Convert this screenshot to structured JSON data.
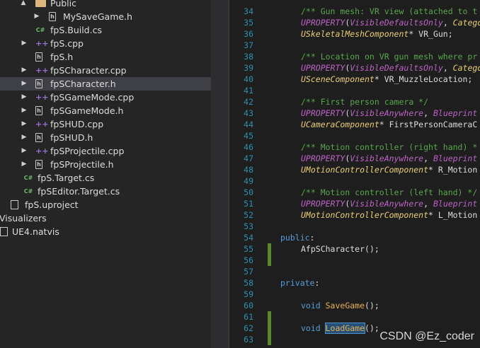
{
  "explorer": {
    "items": [
      {
        "label": "Public",
        "icon": "folder-icon",
        "arrow": "▲",
        "selected": false
      },
      {
        "label": "MySaveGame.h",
        "icon": "header-file-icon",
        "arrow": "▶",
        "selected": false
      },
      {
        "label": "fpS.Build.cs",
        "icon": "csharp-file-icon",
        "arrow": "",
        "selected": false
      },
      {
        "label": "fpS.cpp",
        "icon": "cpp-file-icon",
        "arrow": "▶",
        "selected": false
      },
      {
        "label": "fpS.h",
        "icon": "header-file-icon",
        "arrow": "",
        "selected": false
      },
      {
        "label": "fpSCharacter.cpp",
        "icon": "cpp-file-icon",
        "arrow": "▶",
        "selected": false
      },
      {
        "label": "fpSCharacter.h",
        "icon": "header-file-icon",
        "arrow": "▶",
        "selected": true
      },
      {
        "label": "fpSGameMode.cpp",
        "icon": "cpp-file-icon",
        "arrow": "▶",
        "selected": false
      },
      {
        "label": "fpSGameMode.h",
        "icon": "header-file-icon",
        "arrow": "▶",
        "selected": false
      },
      {
        "label": "fpSHUD.cpp",
        "icon": "cpp-file-icon",
        "arrow": "▶",
        "selected": false
      },
      {
        "label": "fpSHUD.h",
        "icon": "header-file-icon",
        "arrow": "▶",
        "selected": false
      },
      {
        "label": "fpSProjectile.cpp",
        "icon": "cpp-file-icon",
        "arrow": "▶",
        "selected": false
      },
      {
        "label": "fpSProjectile.h",
        "icon": "header-file-icon",
        "arrow": "▶",
        "selected": false
      },
      {
        "label": "fpS.Target.cs",
        "icon": "csharp-file-icon",
        "arrow": "",
        "selected": false
      },
      {
        "label": "fpSEditor.Target.cs",
        "icon": "csharp-file-icon",
        "arrow": "",
        "selected": false
      },
      {
        "label": "fpS.uproject",
        "icon": "project-file-icon",
        "arrow": "",
        "selected": false
      },
      {
        "label": "Visualizers",
        "icon": "",
        "arrow": "",
        "selected": false
      },
      {
        "label": "UE4.natvis",
        "icon": "file-icon",
        "arrow": "",
        "selected": false
      }
    ],
    "icon_glyphs": {
      "cpp": "++",
      "csharp": "C#",
      "header": "h"
    }
  },
  "editor": {
    "lines": [
      {
        "n": "34",
        "tokens": [
          {
            "t": "/** Gun mesh: VR view (attached to t",
            "c": "c-comment"
          }
        ]
      },
      {
        "n": "35",
        "tokens": [
          {
            "t": "UPROPERTY",
            "c": "c-macro"
          },
          {
            "t": "(",
            "c": "c-plain"
          },
          {
            "t": "VisibleDefaultsOnly",
            "c": "c-macro"
          },
          {
            "t": ", ",
            "c": "c-plain"
          },
          {
            "t": "Catego",
            "c": "c-type"
          }
        ]
      },
      {
        "n": "36",
        "tokens": [
          {
            "t": "USkeletalMeshComponent",
            "c": "c-type"
          },
          {
            "t": "* VR_Gun;",
            "c": "c-plain"
          }
        ]
      },
      {
        "n": "37",
        "tokens": []
      },
      {
        "n": "38",
        "tokens": [
          {
            "t": "/** Location on VR gun mesh where pr",
            "c": "c-comment"
          }
        ]
      },
      {
        "n": "39",
        "tokens": [
          {
            "t": "UPROPERTY",
            "c": "c-macro"
          },
          {
            "t": "(",
            "c": "c-plain"
          },
          {
            "t": "VisibleDefaultsOnly",
            "c": "c-macro"
          },
          {
            "t": ", ",
            "c": "c-plain"
          },
          {
            "t": "Catego",
            "c": "c-type"
          }
        ]
      },
      {
        "n": "40",
        "tokens": [
          {
            "t": "USceneComponent",
            "c": "c-type"
          },
          {
            "t": "* VR_MuzzleLocation;",
            "c": "c-plain"
          }
        ]
      },
      {
        "n": "41",
        "tokens": []
      },
      {
        "n": "42",
        "tokens": [
          {
            "t": "/** First person camera */",
            "c": "c-comment"
          }
        ]
      },
      {
        "n": "43",
        "tokens": [
          {
            "t": "UPROPERTY",
            "c": "c-macro"
          },
          {
            "t": "(",
            "c": "c-plain"
          },
          {
            "t": "VisibleAnywhere",
            "c": "c-macro"
          },
          {
            "t": ", ",
            "c": "c-plain"
          },
          {
            "t": "Blueprint",
            "c": "c-macro"
          }
        ]
      },
      {
        "n": "44",
        "tokens": [
          {
            "t": "UCameraComponent",
            "c": "c-type"
          },
          {
            "t": "* FirstPersonCameraC",
            "c": "c-plain"
          }
        ]
      },
      {
        "n": "45",
        "tokens": []
      },
      {
        "n": "46",
        "tokens": [
          {
            "t": "/** Motion controller (right hand) *",
            "c": "c-comment"
          }
        ]
      },
      {
        "n": "47",
        "tokens": [
          {
            "t": "UPROPERTY",
            "c": "c-macro"
          },
          {
            "t": "(",
            "c": "c-plain"
          },
          {
            "t": "VisibleAnywhere",
            "c": "c-macro"
          },
          {
            "t": ", ",
            "c": "c-plain"
          },
          {
            "t": "Blueprint",
            "c": "c-macro"
          }
        ]
      },
      {
        "n": "48",
        "tokens": [
          {
            "t": "UMotionControllerComponent",
            "c": "c-type"
          },
          {
            "t": "* R_Motion",
            "c": "c-plain"
          }
        ]
      },
      {
        "n": "49",
        "tokens": []
      },
      {
        "n": "50",
        "tokens": [
          {
            "t": "/** Motion controller (left hand) */",
            "c": "c-comment"
          }
        ]
      },
      {
        "n": "51",
        "tokens": [
          {
            "t": "UPROPERTY",
            "c": "c-macro"
          },
          {
            "t": "(",
            "c": "c-plain"
          },
          {
            "t": "VisibleAnywhere",
            "c": "c-macro"
          },
          {
            "t": ", ",
            "c": "c-plain"
          },
          {
            "t": "Blueprint",
            "c": "c-macro"
          }
        ]
      },
      {
        "n": "52",
        "tokens": [
          {
            "t": "UMotionControllerComponent",
            "c": "c-type"
          },
          {
            "t": "* L_Motion",
            "c": "c-plain"
          }
        ]
      },
      {
        "n": "53",
        "tokens": []
      },
      {
        "n": "54",
        "tokens": [
          {
            "t": "public",
            "c": "c-kw"
          },
          {
            "t": ":",
            "c": "c-plain"
          }
        ]
      },
      {
        "n": "55",
        "tokens": [
          {
            "t": "AfpSCharacter",
            "c": "c-plain"
          },
          {
            "t": "();",
            "c": "c-plain"
          }
        ]
      },
      {
        "n": "56",
        "tokens": []
      },
      {
        "n": "57",
        "tokens": []
      },
      {
        "n": "58",
        "tokens": [
          {
            "t": "private",
            "c": "c-kw"
          },
          {
            "t": ":",
            "c": "c-plain"
          }
        ]
      },
      {
        "n": "59",
        "tokens": []
      },
      {
        "n": "60",
        "tokens": [
          {
            "t": "void ",
            "c": "c-kw"
          },
          {
            "t": "SaveGame",
            "c": "c-fn"
          },
          {
            "t": "();",
            "c": "c-plain"
          }
        ]
      },
      {
        "n": "61",
        "tokens": []
      },
      {
        "n": "62",
        "tokens": [
          {
            "t": "void ",
            "c": "c-kw"
          },
          {
            "t": "LoadGame",
            "c": "c-fn hl"
          },
          {
            "t": "();",
            "c": "c-plain"
          }
        ]
      },
      {
        "n": "63",
        "tokens": []
      }
    ]
  },
  "watermark": "CSDN @Ez_coder"
}
